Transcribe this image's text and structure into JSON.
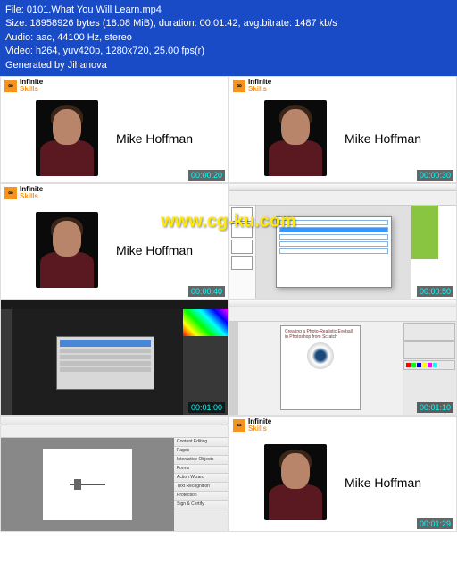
{
  "header": {
    "file": "File: 0101.What You Will Learn.mp4",
    "size": "Size: 18958926 bytes (18.08 MiB), duration: 00:01:42, avg.bitrate: 1487 kb/s",
    "audio": "Audio: aac, 44100 Hz, stereo",
    "video": "Video: h264, yuv420p, 1280x720, 25.00 fps(r)",
    "generated": "Generated by Jihanova"
  },
  "logo": {
    "word1": "Infinite",
    "word2": "Skills"
  },
  "person": {
    "name": "Mike Hoffman"
  },
  "timestamps": {
    "t1": "00:00:20",
    "t2": "00:00:30",
    "t3": "00:00:40",
    "t4": "00:00:50",
    "t5": "00:01:00",
    "t6": "00:01:10",
    "t7": "00:01:29"
  },
  "watermark": "www.cg-ku.com",
  "indesign": {
    "page_title": "Creating a Photo-Realistic Eyeball in Photoshop from Scratch"
  },
  "acrobat": {
    "side_items": [
      "Content Editing",
      "Pages",
      "Interactive Objects",
      "Forms",
      "Action Wizard",
      "Text Recognition",
      "Protection",
      "Sign & Certify"
    ]
  }
}
